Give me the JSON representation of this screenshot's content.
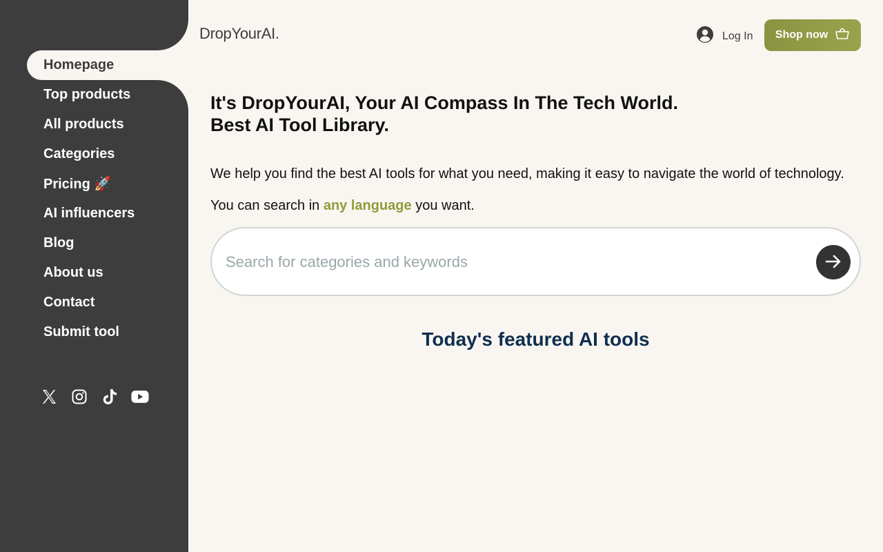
{
  "brand": {
    "logo_text": "DropYourAI."
  },
  "sidebar": {
    "items": [
      {
        "label": "Homepage",
        "active": true
      },
      {
        "label": "Top products"
      },
      {
        "label": "All products"
      },
      {
        "label": "Categories"
      },
      {
        "label": "Pricing 🚀"
      },
      {
        "label": "AI influencers"
      },
      {
        "label": "Blog"
      },
      {
        "label": "About us"
      },
      {
        "label": "Contact"
      },
      {
        "label": "Submit tool"
      }
    ],
    "social_icons": [
      "x-icon",
      "instagram-icon",
      "tiktok-icon",
      "youtube-icon"
    ]
  },
  "header": {
    "login_label": "Log In",
    "shop_label": "Shop now"
  },
  "main": {
    "headline_line1": "It's DropYourAI, Your AI Compass In The Tech World.",
    "headline_line2": "Best AI Tool Library.",
    "para1": "We help you find the best AI tools for what you need, making it easy to navigate the world of technology.",
    "para2_before": "You can search in ",
    "para2_highlight": "any language",
    "para2_after": " you want.",
    "search_placeholder": "Search for categories and keywords",
    "featured_title": "Today's featured AI tools"
  },
  "colors": {
    "sidebar_bg": "#3d3d3d",
    "page_bg": "#f9f6f1",
    "accent": "#8f9b3a",
    "featured_title": "#0f2e4f"
  }
}
